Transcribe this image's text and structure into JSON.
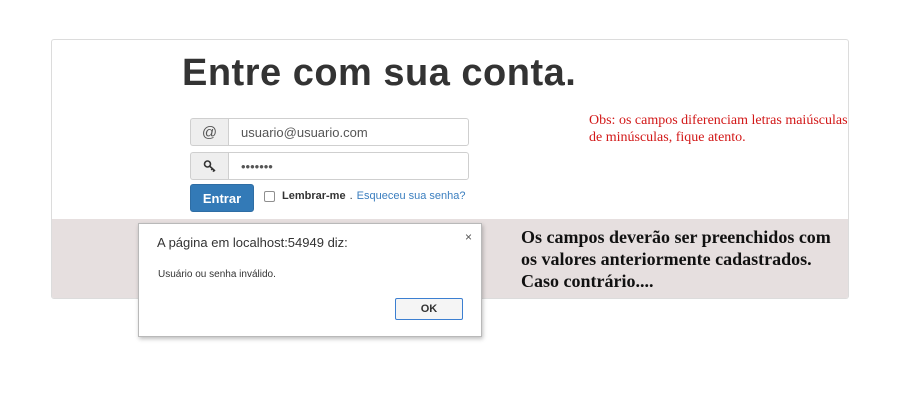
{
  "login": {
    "title": "Entre com sua conta.",
    "email_icon": "@",
    "email_value": "usuario@usuario.com",
    "password_icon": "key-icon",
    "password_value": "•••••••",
    "submit_label": "Entrar",
    "remember_label": "Lembrar-me",
    "separator": ".",
    "forgot_link": "Esqueceu sua senha?"
  },
  "obs_note": "Obs: os campos diferenciam letras maiúsculas de minúsculas, fique atento.",
  "alert": {
    "title": "A página em localhost:54949 diz:",
    "close": "×",
    "message": "Usuário ou senha inválido.",
    "ok_label": "OK"
  },
  "side_note": "Os campos deverão ser preenchidos com os valores anteriormente cadastrados. Caso contrário...."
}
